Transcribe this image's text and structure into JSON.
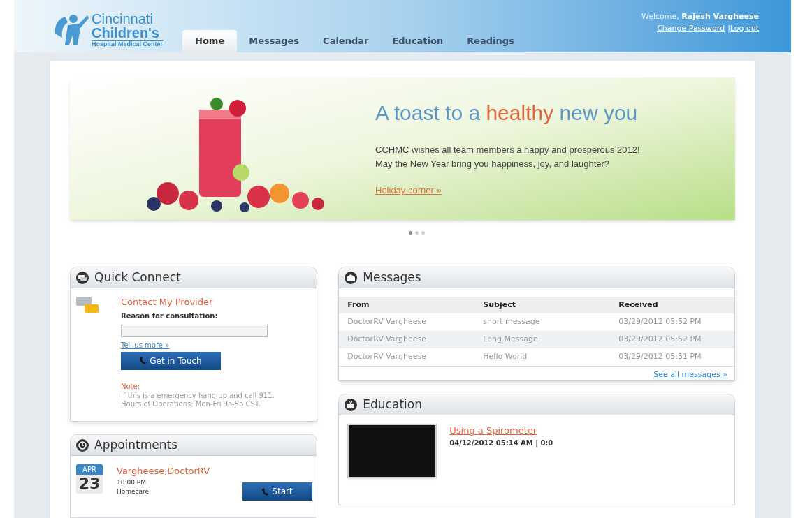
{
  "header": {
    "logo": {
      "line1": "Cincinnati",
      "line2": "Children's",
      "line3": "Hospital Medical Center"
    },
    "welcome": {
      "prefix": "Welcome,",
      "user": "Rajesh Vargheese"
    },
    "links": [
      {
        "label": "Change Password"
      },
      {
        "label": "|Log out"
      }
    ],
    "tabs": [
      {
        "label": "Home",
        "selected": true
      },
      {
        "label": "Messages",
        "selected": false
      },
      {
        "label": "Calendar",
        "selected": false
      },
      {
        "label": "Education",
        "selected": false
      },
      {
        "label": "Readings",
        "selected": false
      }
    ]
  },
  "banner": {
    "headline": [
      {
        "text": "A toast to a ",
        "kind": "plain"
      },
      {
        "text": "healthy",
        "kind": "accent"
      },
      {
        "text": " new you",
        "kind": "plain"
      }
    ],
    "lines": [
      "CCHMC wishes all team members a happy and prosperous 2012!",
      "May the New Year bring you happiness, joy, and laughter?"
    ],
    "link": "Holiday corner »",
    "dots": [
      {
        "selected": true
      },
      {
        "selected": false
      },
      {
        "selected": false
      }
    ]
  },
  "quick_connect": {
    "title": "Quick Connect",
    "heading": "Contact My Provider",
    "label": "Reason for consultation:",
    "link": "Tell us more »",
    "button": "Get in Touch",
    "note_title": "Note:",
    "note_lines": [
      "If this is a emergency hang up and call 911.",
      "Hours of Operations: Mon-Fri 9a-5p CST."
    ]
  },
  "appointments": {
    "title": "Appointments",
    "items": [
      {
        "month": "APR",
        "day": "23",
        "name": "Vargheese,DoctorRV",
        "time": "10:00 PM",
        "type": "Homecare",
        "button": "Start"
      }
    ]
  },
  "messages": {
    "title": "Messages",
    "columns": [
      "From",
      "Subject",
      "Received"
    ],
    "rows": [
      [
        "DoctorRV Vargheese",
        "short message",
        "03/29/2012 05:52 PM"
      ],
      [
        "DoctorRV Vargheese",
        "Long Message",
        "03/29/2012 05:52 PM"
      ],
      [
        "DoctorRV Vargheese",
        "Hello World",
        "03/29/2012 05:51 PM"
      ]
    ],
    "link": "See all messages »"
  },
  "education": {
    "title": "Education",
    "items": [
      {
        "title": "Using a Spirometer",
        "meta": "04/12/2012 05:14 AM | 0:0"
      }
    ]
  }
}
